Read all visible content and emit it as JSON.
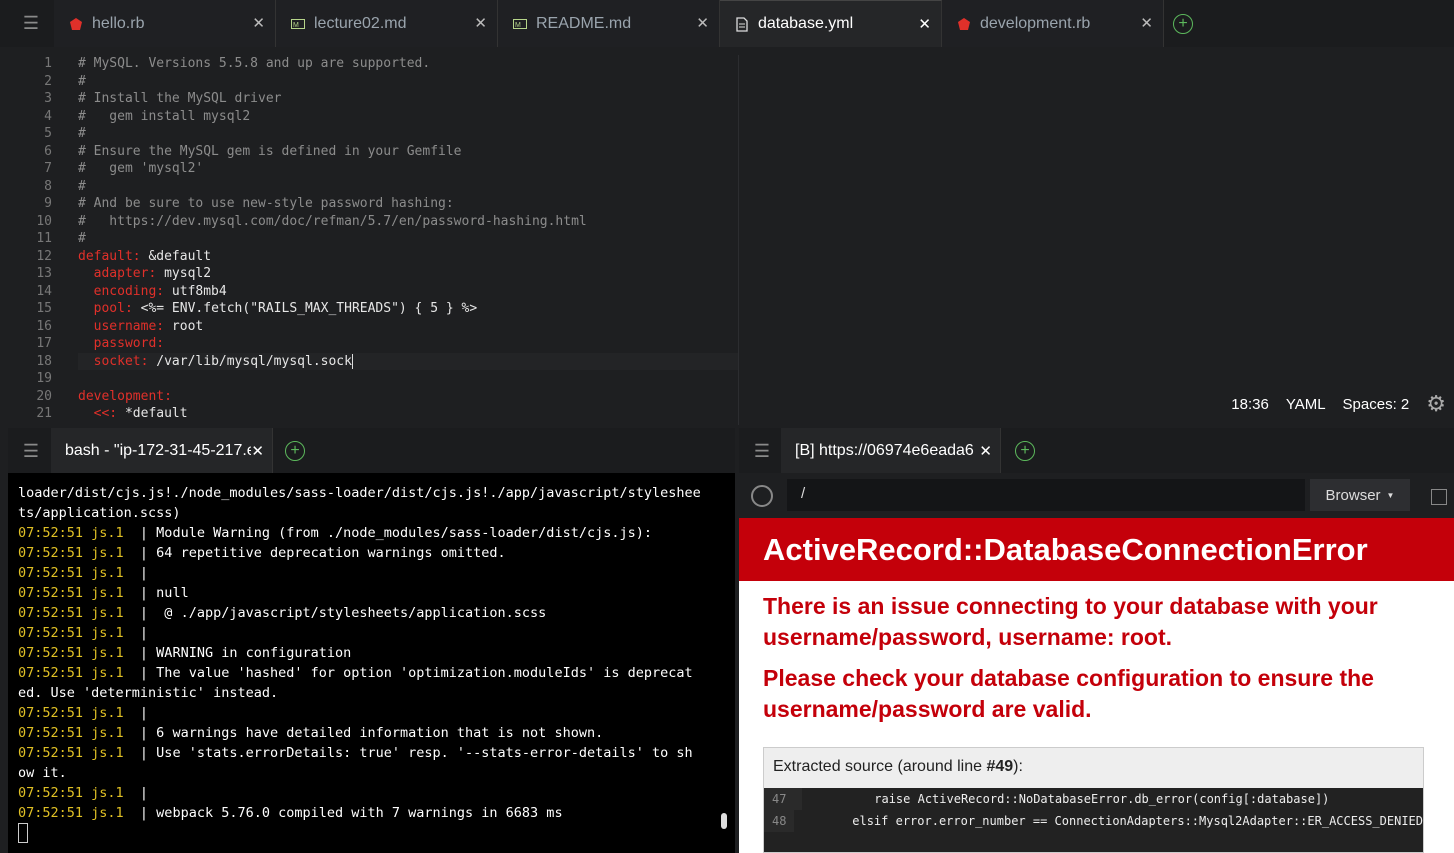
{
  "tabs": [
    {
      "label": "hello.rb",
      "icon": "ruby-icon"
    },
    {
      "label": "lecture02.md",
      "icon": "markdown-icon"
    },
    {
      "label": "README.md",
      "icon": "markdown-icon"
    },
    {
      "label": "database.yml",
      "icon": "file-icon",
      "active": true
    },
    {
      "label": "development.rb",
      "icon": "ruby-icon"
    }
  ],
  "editor": {
    "lines": [
      "1",
      "2",
      "3",
      "4",
      "5",
      "6",
      "7",
      "8",
      "9",
      "10",
      "11",
      "12",
      "13",
      "14",
      "15",
      "16",
      "17",
      "18",
      "19",
      "20",
      "21"
    ],
    "code": [
      {
        "k": "",
        "v": "# MySQL. Versions 5.5.8 and up are supported.",
        "c": true
      },
      {
        "k": "",
        "v": "#",
        "c": true
      },
      {
        "k": "",
        "v": "# Install the MySQL driver",
        "c": true
      },
      {
        "k": "",
        "v": "#   gem install mysql2",
        "c": true
      },
      {
        "k": "",
        "v": "#",
        "c": true
      },
      {
        "k": "",
        "v": "# Ensure the MySQL gem is defined in your Gemfile",
        "c": true
      },
      {
        "k": "",
        "v": "#   gem 'mysql2'",
        "c": true
      },
      {
        "k": "",
        "v": "#",
        "c": true
      },
      {
        "k": "",
        "v": "# And be sure to use new-style password hashing:",
        "c": true
      },
      {
        "k": "",
        "v": "#   https://dev.mysql.com/doc/refman/5.7/en/password-hashing.html",
        "c": true
      },
      {
        "k": "",
        "v": "#",
        "c": true
      },
      {
        "k": "default:",
        "v": " &default"
      },
      {
        "k": "  adapter:",
        "v": " mysql2"
      },
      {
        "k": "  encoding:",
        "v": " utf8mb4"
      },
      {
        "k": "  pool:",
        "v": " <%= ENV.fetch(\"RAILS_MAX_THREADS\") { 5 } %>"
      },
      {
        "k": "  username:",
        "v": " root"
      },
      {
        "k": "  password:",
        "v": ""
      },
      {
        "k": "  socket:",
        "v": " /var/lib/mysql/mysql.sock"
      },
      {
        "k": "",
        "v": ""
      },
      {
        "k": "development:",
        "v": ""
      },
      {
        "k": "  <<:",
        "v": " *default"
      }
    ],
    "status": {
      "cursor": "18:36",
      "mode": "YAML",
      "spaces": "Spaces: 2"
    }
  },
  "terminal": {
    "tab_label": "bash - \"ip-172-31-45-217.e",
    "lines": [
      {
        "ts": "",
        "text": "loader/dist/cjs.js!./node_modules/sass-loader/dist/cjs.js!./app/javascript/styleshee"
      },
      {
        "ts": "",
        "text": "ts/application.scss)"
      },
      {
        "ts": "07:52:51 js.1",
        "text": "  | Module Warning (from ./node_modules/sass-loader/dist/cjs.js):"
      },
      {
        "ts": "07:52:51 js.1",
        "text": "  | 64 repetitive deprecation warnings omitted."
      },
      {
        "ts": "07:52:51 js.1",
        "text": "  |"
      },
      {
        "ts": "07:52:51 js.1",
        "text": "  | null"
      },
      {
        "ts": "07:52:51 js.1",
        "text": "  |  @ ./app/javascript/stylesheets/application.scss"
      },
      {
        "ts": "07:52:51 js.1",
        "text": "  |"
      },
      {
        "ts": "07:52:51 js.1",
        "text": "  | WARNING in configuration"
      },
      {
        "ts": "07:52:51 js.1",
        "text": "  | The value 'hashed' for option 'optimization.moduleIds' is deprecat"
      },
      {
        "ts": "",
        "text": "ed. Use 'deterministic' instead."
      },
      {
        "ts": "07:52:51 js.1",
        "text": "  |"
      },
      {
        "ts": "07:52:51 js.1",
        "text": "  | 6 warnings have detailed information that is not shown."
      },
      {
        "ts": "07:52:51 js.1",
        "text": "  | Use 'stats.errorDetails: true' resp. '--stats-error-details' to sh"
      },
      {
        "ts": "",
        "text": "ow it."
      },
      {
        "ts": "07:52:51 js.1",
        "text": "  |"
      },
      {
        "ts": "07:52:51 js.1",
        "text": "  | webpack 5.76.0 compiled with 7 warnings in 6683 ms"
      }
    ]
  },
  "browser": {
    "tab_label": "[B] https://06974e6eada6",
    "address": "/",
    "browser_button": "Browser",
    "error_title": "ActiveRecord::DatabaseConnectionError",
    "message1": "There is an issue connecting to your database with your username/password, username: root.",
    "message2": "Please check your database configuration to ensure the username/password are valid.",
    "source_heading_prefix": "Extracted source (around line ",
    "source_heading_line": "#49",
    "source_heading_suffix": "):",
    "source_lines": [
      {
        "n": "47",
        "code": "          raise ActiveRecord::NoDatabaseError.db_error(config[:database])"
      },
      {
        "n": "48",
        "code": "        elsif error.error_number == ConnectionAdapters::Mysql2Adapter::ER_ACCESS_DENIED"
      }
    ]
  },
  "colors": {
    "accent_red": "#c4000a",
    "timestamp": "#e0c025",
    "yaml_key": "#e0302a"
  }
}
